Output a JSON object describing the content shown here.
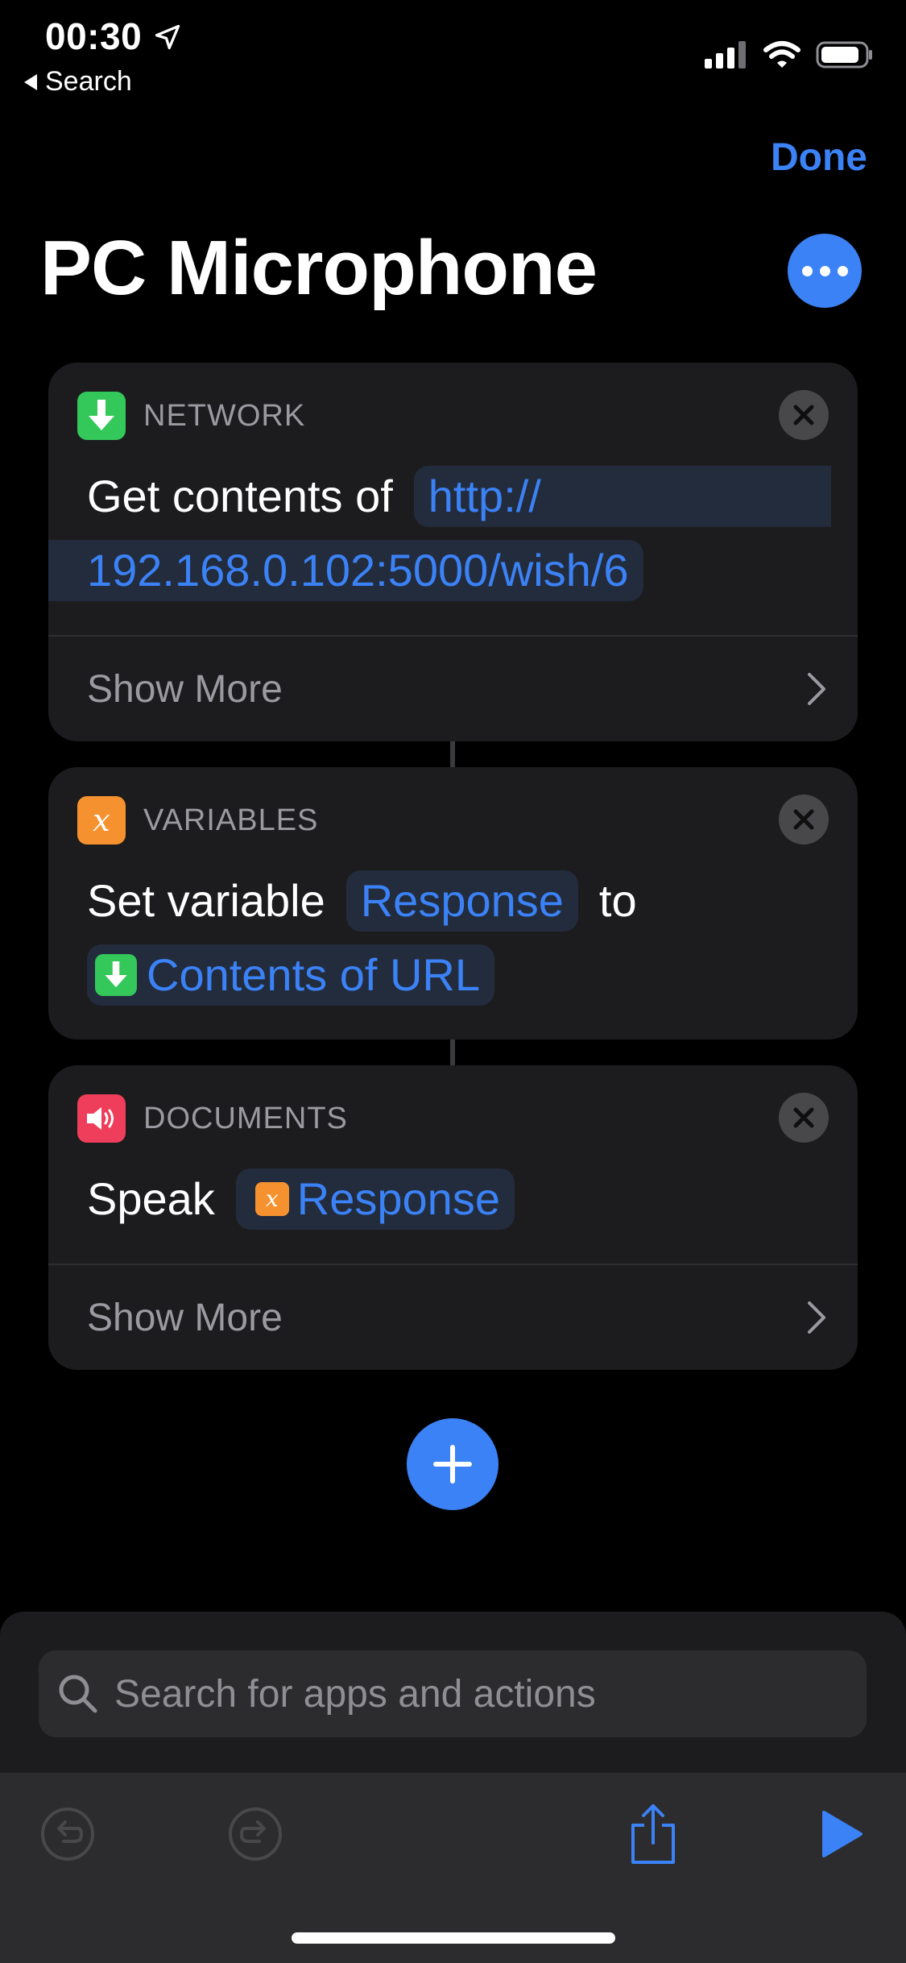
{
  "status_bar": {
    "time": "00:30",
    "back_label": "Search"
  },
  "header": {
    "done_label": "Done",
    "title": "PC Microphone"
  },
  "actions": [
    {
      "category": "NETWORK",
      "text_prefix": "Get contents of",
      "url_line1": "http://",
      "url_line2": "192.168.0.102:5000/wish/6",
      "show_more_label": "Show More",
      "icon": "download-arrow-icon",
      "color": "#34c759"
    },
    {
      "category": "VARIABLES",
      "text_prefix": "Set variable",
      "variable_name": "Response",
      "text_middle": "to",
      "value_token": "Contents of URL",
      "icon": "variable-x-icon",
      "color": "#f5922f"
    },
    {
      "category": "DOCUMENTS",
      "text_prefix": "Speak",
      "value_token": "Response",
      "show_more_label": "Show More",
      "icon": "speaker-icon",
      "color": "#ef3e5c"
    }
  ],
  "search": {
    "placeholder": "Search for apps and actions"
  },
  "colors": {
    "accent": "#3b82f6",
    "card": "#1c1c1e",
    "token_bg": "#232c3d"
  }
}
